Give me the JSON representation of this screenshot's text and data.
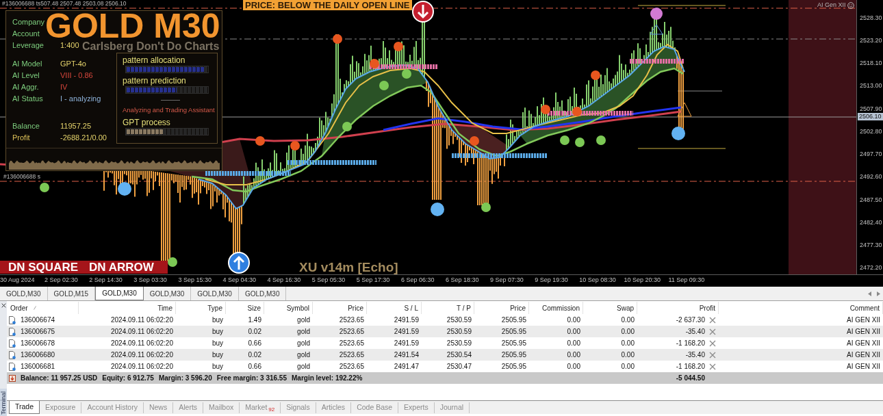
{
  "chart": {
    "order_label": "#136006688 ts",
    "quote": "507.48 2507.48 2503.08 2506.10",
    "info_panel": {
      "title": "GOLD M30",
      "subtitle": "Carlsberg Don't Do Charts",
      "account_rows": [
        {
          "label": "Company"
        },
        {
          "label": "Account"
        },
        {
          "label": "Leverage",
          "value": "1:400"
        }
      ],
      "ai_rows": [
        {
          "label": "AI Model",
          "value": "GPT-4o",
          "color": "#e6d46c"
        },
        {
          "label": "AI Level",
          "value": "VIII - 0.86",
          "color": "#d9473c"
        },
        {
          "label": "AI Aggr.",
          "value": "IV",
          "color": "#d9473c"
        },
        {
          "label": "AI Status",
          "value": "I - analyzing",
          "color": "#8fb4dc"
        }
      ],
      "summary_rows": [
        {
          "label": "Balance",
          "value": "11957.25",
          "color": "#7fcf7f"
        },
        {
          "label": "Profit",
          "value": "-2688.21/0.00",
          "color": "#e0c45a"
        }
      ],
      "meters": [
        {
          "label": "pattern allocation",
          "level": 0.96
        },
        {
          "label": "pattern prediction",
          "level": 0.62
        }
      ],
      "assistant": "Analyzing and Trading Assistant",
      "process": {
        "label": "GPT process",
        "level": 0.45
      }
    },
    "signal_label": "PRICE: BELOW THE DAILY OPEN LINE",
    "indicator_label": "AI Gen XII",
    "order_line_label": "#136006688 s",
    "signals": [
      "DN SQUARE",
      "DN ARROW"
    ],
    "version": "XU v14m [Echo]",
    "price_axis": [
      "2528.30",
      "2523.20",
      "2518.10",
      "2513.00",
      "2507.90",
      "2502.80",
      "2497.70",
      "2492.60",
      "2487.50",
      "2482.40",
      "2477.30",
      "2472.20"
    ],
    "current_price": "2506.10",
    "time_axis": [
      "30 Aug 2024",
      "2 Sep 02:30",
      "2 Sep 14:30",
      "3 Sep 03:30",
      "3 Sep 15:30",
      "4 Sep 04:30",
      "4 Sep 16:30",
      "5 Sep 05:30",
      "5 Sep 17:30",
      "6 Sep 06:30",
      "6 Sep 18:30",
      "9 Sep 07:30",
      "9 Sep 19:30",
      "10 Sep 08:30",
      "10 Sep 20:30",
      "11 Sep 09:30"
    ]
  },
  "chart_tabs": [
    {
      "label": "GOLD,M30",
      "selected": false
    },
    {
      "label": "GOLD,M15",
      "selected": false
    },
    {
      "label": "GOLD,M30",
      "selected": true
    },
    {
      "label": "GOLD,M30",
      "selected": false
    },
    {
      "label": "GOLD,M30",
      "selected": false
    },
    {
      "label": "GOLD,M30",
      "selected": false
    }
  ],
  "terminal": {
    "title": "Terminal",
    "columns": [
      "Order",
      "Time",
      "Type",
      "Size",
      "Symbol",
      "Price",
      "S / L",
      "T / P",
      "Price",
      "Commission",
      "Swap",
      "Profit",
      "Comment"
    ],
    "rows": [
      [
        "136006674",
        "2024.09.11 06:02:20",
        "buy",
        "1.49",
        "gold",
        "2523.65",
        "2491.59",
        "2530.59",
        "2505.95",
        "0.00",
        "0.00",
        "-2 637.30",
        "AI GEN XII"
      ],
      [
        "136006675",
        "2024.09.11 06:02:20",
        "buy",
        "0.02",
        "gold",
        "2523.65",
        "2491.59",
        "2530.59",
        "2505.95",
        "0.00",
        "0.00",
        "-35.40",
        "AI GEN XII"
      ],
      [
        "136006678",
        "2024.09.11 06:02:20",
        "buy",
        "0.66",
        "gold",
        "2523.65",
        "2491.59",
        "2530.59",
        "2505.95",
        "0.00",
        "0.00",
        "-1 168.20",
        "AI GEN XII"
      ],
      [
        "136006680",
        "2024.09.11 06:02:20",
        "buy",
        "0.02",
        "gold",
        "2523.65",
        "2491.54",
        "2530.54",
        "2505.95",
        "0.00",
        "0.00",
        "-35.40",
        "AI GEN XII"
      ],
      [
        "136006681",
        "2024.09.11 06:02:20",
        "buy",
        "0.66",
        "gold",
        "2523.65",
        "2491.47",
        "2530.47",
        "2505.95",
        "0.00",
        "0.00",
        "-1 168.20",
        "AI GEN XII"
      ]
    ],
    "summary": {
      "items": [
        "Balance: 11 957.25 USD",
        "Equity: 6 912.75",
        "Margin: 3 596.20",
        "Free margin: 3 316.55",
        "Margin level: 192.22%"
      ],
      "profit": "-5 044.50"
    },
    "tabs": [
      {
        "label": "Trade",
        "selected": true
      },
      {
        "label": "Exposure",
        "selected": false
      },
      {
        "label": "Account History",
        "selected": false
      },
      {
        "label": "News",
        "selected": false
      },
      {
        "label": "Alerts",
        "selected": false
      },
      {
        "label": "Mailbox",
        "selected": false
      },
      {
        "label": "Market",
        "badge": "92",
        "selected": false
      },
      {
        "label": "Signals",
        "selected": false
      },
      {
        "label": "Articles",
        "selected": false
      },
      {
        "label": "Code Base",
        "selected": false
      },
      {
        "label": "Experts",
        "selected": false
      },
      {
        "label": "Journal",
        "selected": false
      }
    ]
  }
}
